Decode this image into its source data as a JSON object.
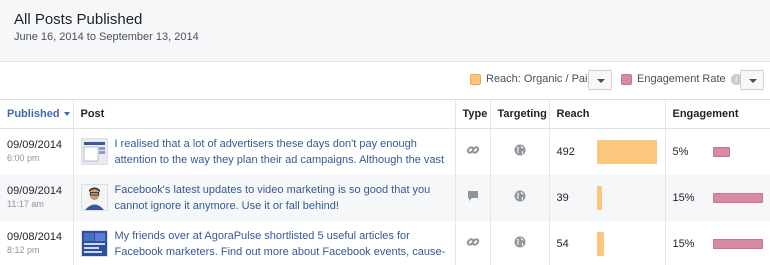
{
  "header": {
    "title": "All Posts Published",
    "date_range": "June 16, 2014 to September 13, 2014"
  },
  "legend": {
    "reach_label": "Reach: Organic / Paid",
    "reach_color": "#fbc77e",
    "engagement_label": "Engagement Rate",
    "engagement_color": "#d88aa2",
    "info_glyph": "i"
  },
  "columns": {
    "published": "Published",
    "post": "Post",
    "type": "Type",
    "targeting": "Targeting",
    "reach": "Reach",
    "engagement": "Engagement"
  },
  "posts": [
    {
      "date": "09/09/2014",
      "time": "6:00 pm",
      "thumb": "screenshot-thumbnail",
      "text": "I realised that a lot of advertisers these days don't pay enough attention to the way they plan their ad campaigns. Although the vast number of",
      "type_icon": "link-icon",
      "targeting_icon": "globe-icon",
      "reach": "492",
      "reach_fraction": 1.0,
      "engagement": "5%",
      "engagement_fraction": 0.33
    },
    {
      "date": "09/09/2014",
      "time": "11:17 am",
      "thumb": "person-thumbnail",
      "text": "Facebook's latest updates to video marketing is so good that you cannot ignore it anymore. Use it or fall behind!",
      "type_icon": "status-icon",
      "targeting_icon": "globe-icon",
      "reach": "39",
      "reach_fraction": 0.08,
      "engagement": "15%",
      "engagement_fraction": 1.0
    },
    {
      "date": "09/08/2014",
      "time": "8:12 pm",
      "thumb": "article-thumbnail",
      "text": "My friends over at AgoraPulse shortlisted 5 useful articles for Facebook marketers. Find out more about Facebook events, cause-marketing, and",
      "type_icon": "link-icon",
      "targeting_icon": "globe-icon",
      "reach": "54",
      "reach_fraction": 0.11,
      "engagement": "15%",
      "engagement_fraction": 1.0
    }
  ]
}
